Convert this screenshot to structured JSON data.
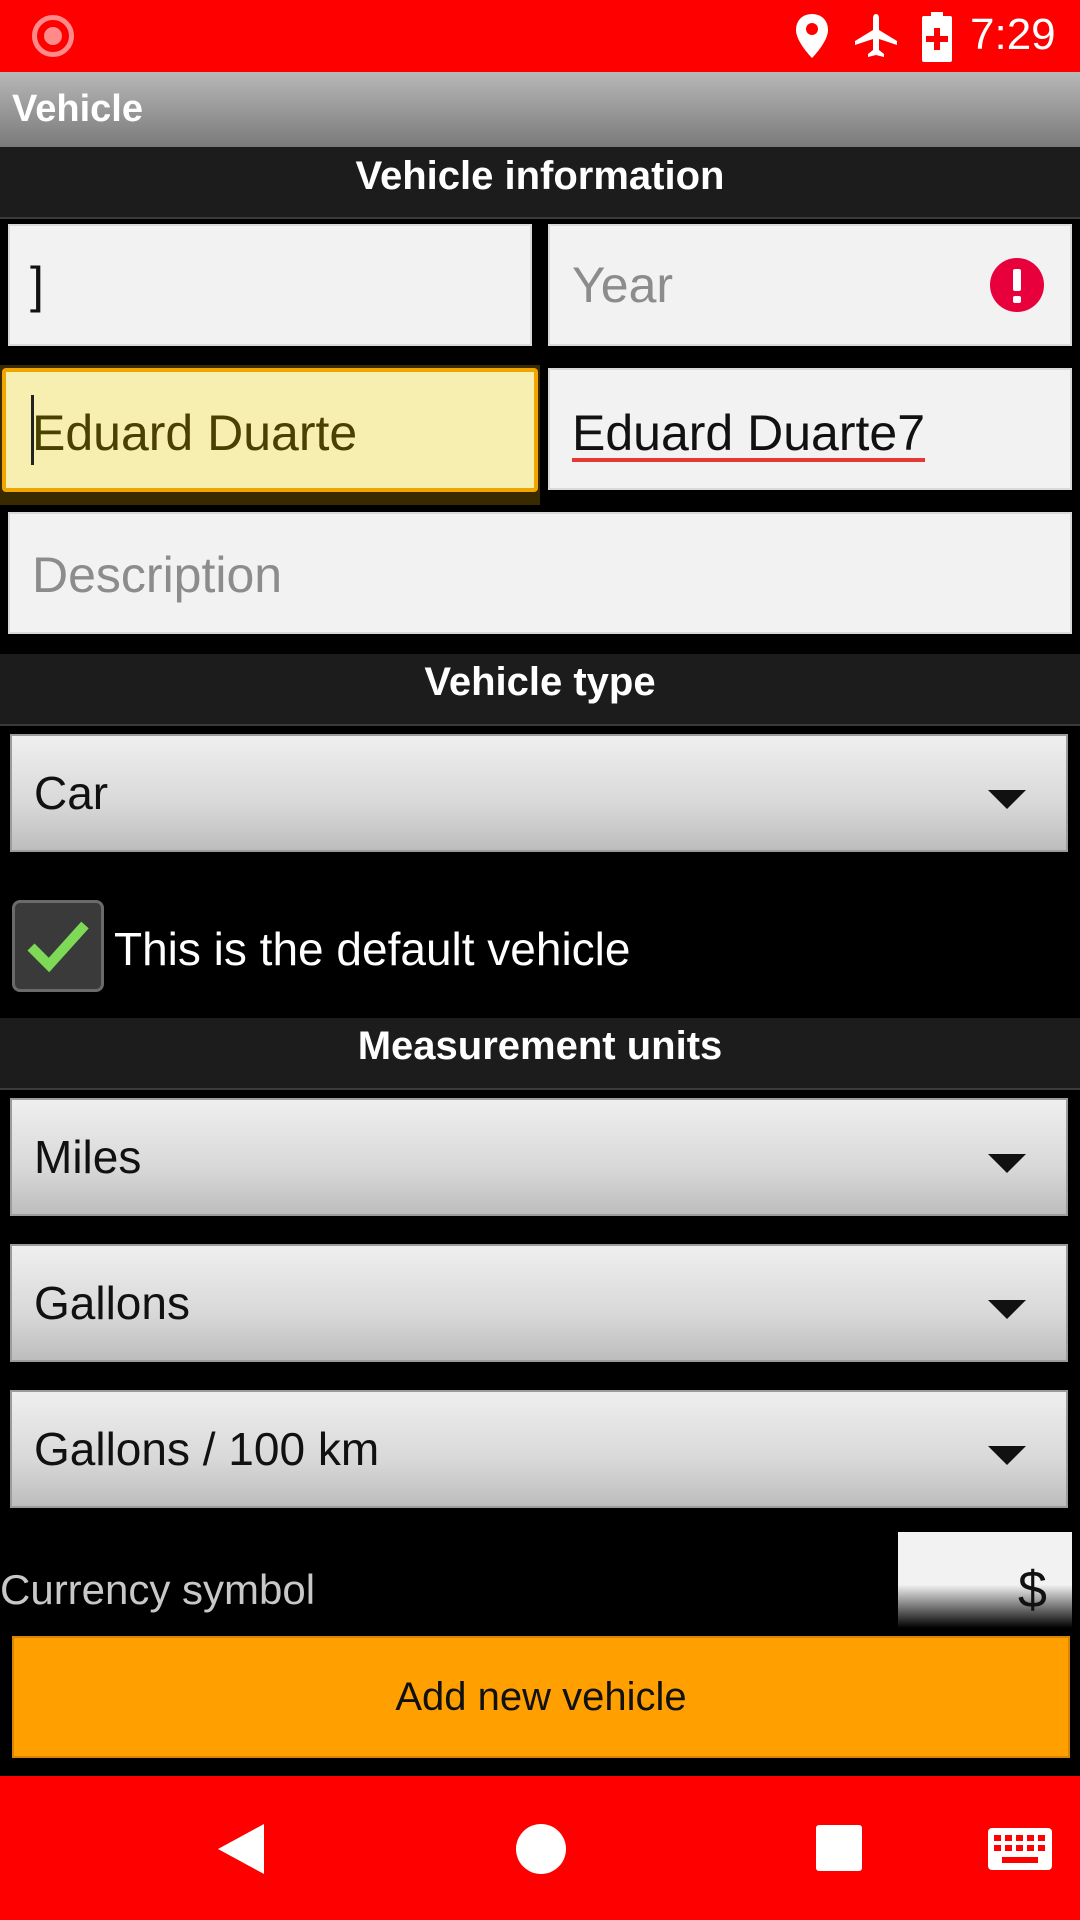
{
  "status_bar": {
    "time": "7:29",
    "icons": [
      "record-icon",
      "location-icon",
      "airplane-icon",
      "battery-icon"
    ]
  },
  "app_bar": {
    "title": "Vehicle"
  },
  "vehicle_info": {
    "header": "Vehicle information",
    "field1_value": "]",
    "year_placeholder": "Year",
    "make_value": "Eduard Duarte",
    "model_value": "Eduard Duarte7",
    "description_placeholder": "Description"
  },
  "vehicle_type": {
    "header": "Vehicle type",
    "selected": "Car",
    "default_checkbox_label": "This is the default vehicle",
    "default_checked": true
  },
  "measurement_units": {
    "header": "Measurement units",
    "distance": "Miles",
    "volume": "Gallons",
    "consumption": "Gallons / 100 km"
  },
  "currency": {
    "label": "Currency symbol",
    "value": "$"
  },
  "add_button_label": "Add new vehicle",
  "colors": {
    "status_bar": "#ff0000",
    "accent": "#ffa000",
    "error": "#e8003d",
    "check": "#7ed957"
  }
}
